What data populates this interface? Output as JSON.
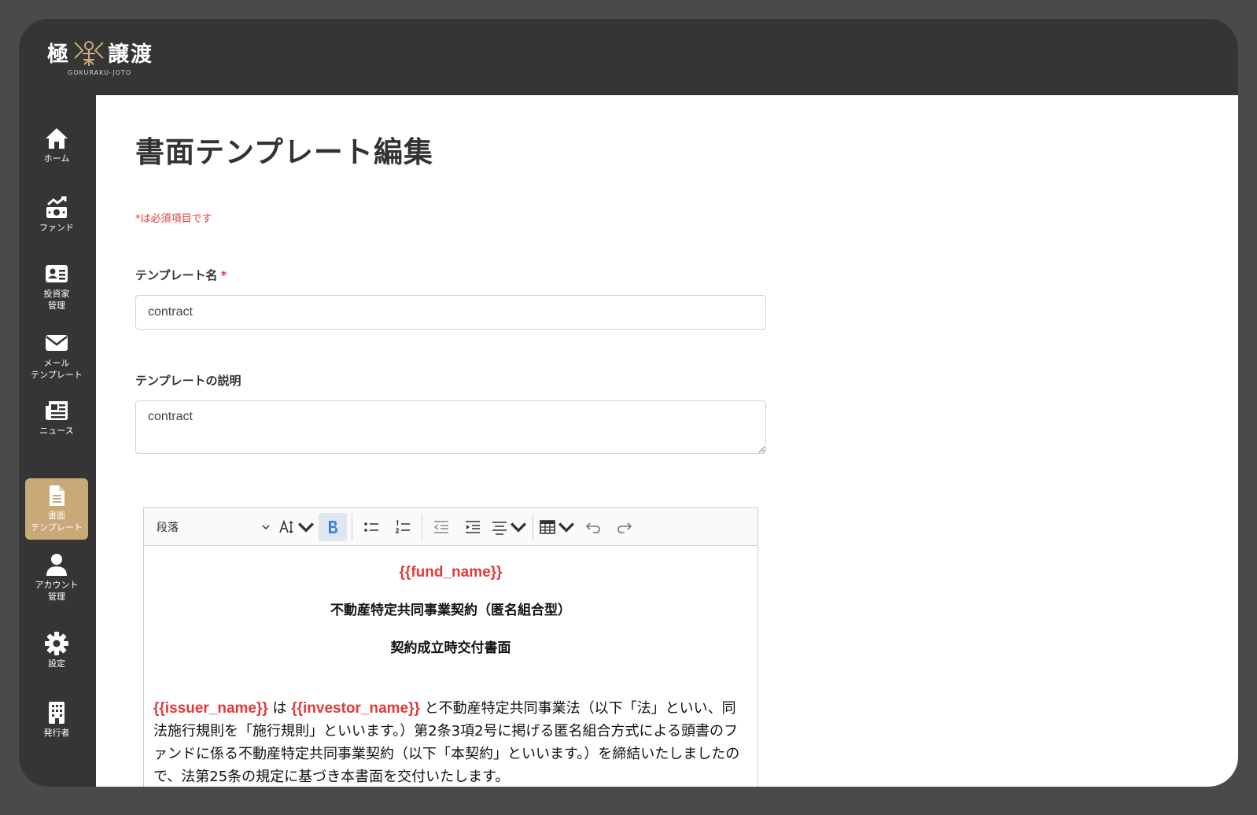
{
  "app": {
    "logo_left": "極",
    "logo_right": "譲渡",
    "logo_sub": "GOKURAKU-JOTO"
  },
  "sidebar": {
    "items": [
      {
        "label": "ホーム",
        "icon": "home-icon"
      },
      {
        "label": "ファンド",
        "icon": "money-chart-icon"
      },
      {
        "label": "投資家\n管理",
        "icon": "id-card-icon"
      },
      {
        "label": "メール\nテンプレート",
        "icon": "envelope-icon"
      },
      {
        "label": "ニュース",
        "icon": "newspaper-icon"
      },
      {
        "label": "書面\nテンプレート",
        "icon": "document-icon",
        "active": true
      },
      {
        "label": "アカウント\n管理",
        "icon": "user-icon"
      },
      {
        "label": "設定",
        "icon": "gear-icon"
      },
      {
        "label": "発行者",
        "icon": "building-icon"
      }
    ]
  },
  "page": {
    "title": "書面テンプレート編集",
    "required_note": "*は必須項目です"
  },
  "form": {
    "name_label": "テンプレート名",
    "name_required_mark": "*",
    "name_value": "contract",
    "desc_label": "テンプレートの説明",
    "desc_value": "contract"
  },
  "editor": {
    "paragraph_select": "段落",
    "content": {
      "fund_name": "{{fund_name}}",
      "heading1": "不動産特定共同事業契約（匿名組合型）",
      "heading2": "契約成立時交付書面",
      "issuer": "{{issuer_name}}",
      "wa": " は ",
      "investor": "{{investor_name}}",
      "body": " と不動産特定共同事業法（以下「法」といい、同法施行規則を「施行規則」といいます。）第2条3項2号に掲げる匿名組合方式による頭書のファンドに係る不動産特定共同事業契約（以下「本契約」といいます。）を締結いたしましたので、法第25条の規定に基づき本書面を交付いたします。"
    }
  },
  "colors": {
    "accent": "#c9a978",
    "required": "#e03b3b",
    "placeholder": "#e03b3b",
    "bold_active": "#3b7ddd"
  }
}
